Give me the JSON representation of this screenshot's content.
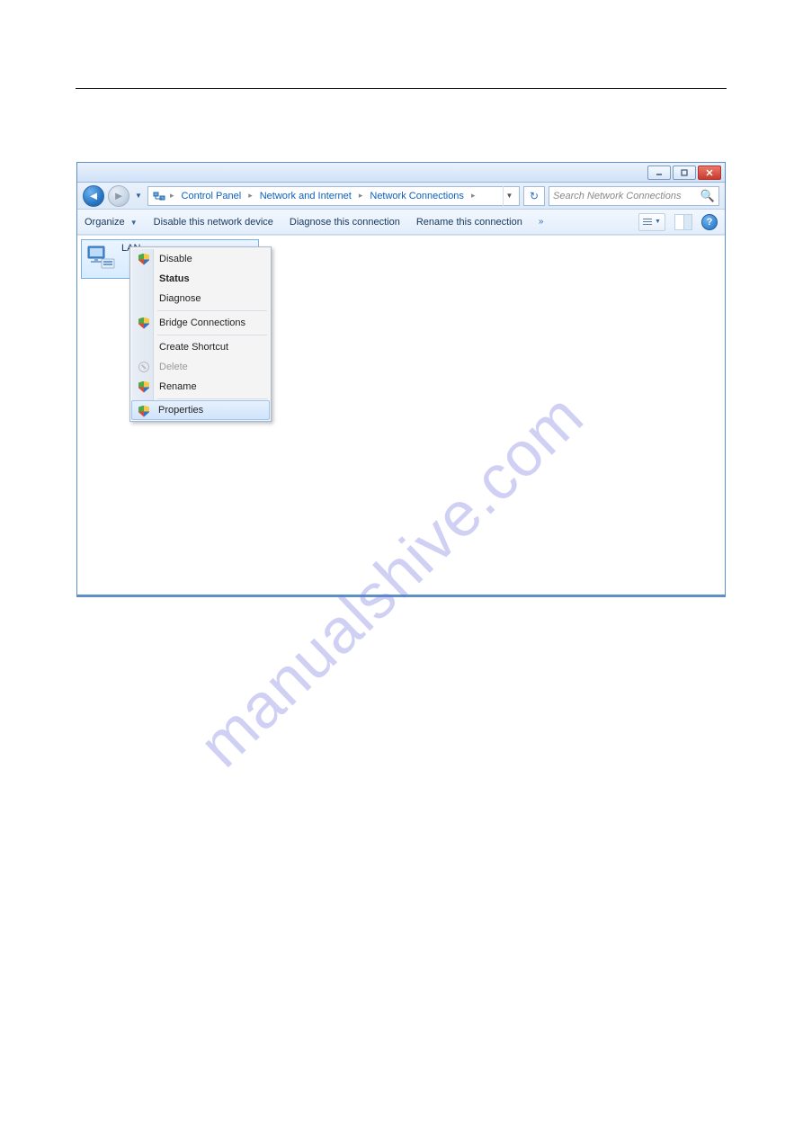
{
  "breadcrumb": {
    "items": [
      "Control Panel",
      "Network and Internet",
      "Network Connections"
    ]
  },
  "search": {
    "placeholder": "Search Network Connections"
  },
  "toolbar": {
    "organize": "Organize",
    "disable": "Disable this network device",
    "diagnose": "Diagnose this connection",
    "rename": "Rename this connection"
  },
  "adapter": {
    "name": "LAN"
  },
  "context_menu": {
    "disable": "Disable",
    "status": "Status",
    "diagnose": "Diagnose",
    "bridge": "Bridge Connections",
    "shortcut": "Create Shortcut",
    "delete": "Delete",
    "rename": "Rename",
    "properties": "Properties"
  },
  "watermark": "manualshive.com"
}
